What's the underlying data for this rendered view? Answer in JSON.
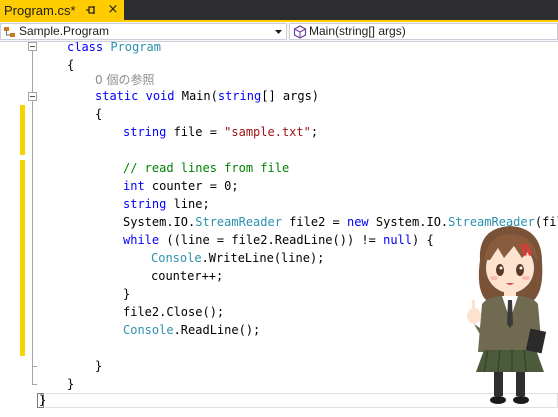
{
  "tab": {
    "title": "Program.cs*",
    "pin_icon": "pin-icon",
    "close_glyph": "×"
  },
  "navbar": {
    "class_selector": "Sample.Program",
    "member_selector": "Main(string[] args)",
    "class_icon": "class-icon",
    "method_icon": "method-icon",
    "dropdown_icon": "chevron-down-icon"
  },
  "code": {
    "line_class": [
      "class",
      " ",
      "Program"
    ],
    "open_brace_1": "{",
    "ref_count": "0 個の参照",
    "line_main": [
      "static",
      " ",
      "void",
      " Main(",
      "string",
      "[] args)"
    ],
    "open_brace_2": "{",
    "line_file": [
      "string",
      " file = ",
      "\"sample.txt\"",
      ";"
    ],
    "comment": "// read lines from file",
    "line_counter": [
      "int",
      " counter = 0;"
    ],
    "line_line": [
      "string",
      " line;"
    ],
    "line_reader": [
      "System.IO.",
      "StreamReader",
      " file2 = ",
      "new",
      " System.IO.",
      "StreamReader",
      "(file"
    ],
    "line_while": [
      "while",
      " ((line = file2.ReadLine()) != ",
      "null",
      ") {"
    ],
    "line_writeline": [
      "Console",
      ".WriteLine(line);"
    ],
    "line_incr": "counter++;",
    "close_brace_while": "}",
    "line_close": "file2.Close();",
    "line_readline": [
      "Console",
      ".ReadLine();"
    ],
    "close_brace_main": "}",
    "close_brace_class": "}",
    "close_brace_ns": "}"
  },
  "colors": {
    "tab_active": "#ffcc00",
    "keyword": "#0000ff",
    "type": "#2b91af",
    "string": "#a31515",
    "comment": "#008000",
    "change_marker": "#f5d400"
  },
  "decoration": {
    "mascot": "anime-girl-mascot"
  }
}
